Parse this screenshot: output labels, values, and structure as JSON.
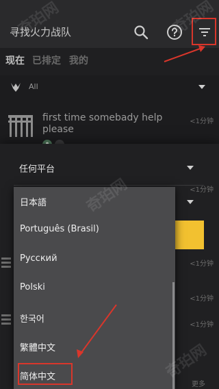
{
  "header": {
    "title": "寻找火力战队"
  },
  "tabs": [
    {
      "label": "现在"
    },
    {
      "label": "已排定"
    },
    {
      "label": "我的"
    }
  ],
  "filter": {
    "value": "All"
  },
  "list": [
    {
      "title": "first time somebady help please",
      "time": "<1分钟"
    }
  ],
  "side_times": [
    "<1分钟",
    "<1分钟",
    "<1分钟",
    "<1分钟"
  ],
  "more_label": "更多",
  "sheet": {
    "platform_label": "任何平台"
  },
  "language_menu": {
    "items": [
      "日本語",
      "Português (Brasil)",
      "Русский",
      "Polski",
      "한국어",
      "繁體中文",
      "简体中文"
    ]
  },
  "watermark_text": "奇珀网",
  "colors": {
    "accent_yellow": "#f2c130",
    "annotation_red": "#d9362b"
  }
}
